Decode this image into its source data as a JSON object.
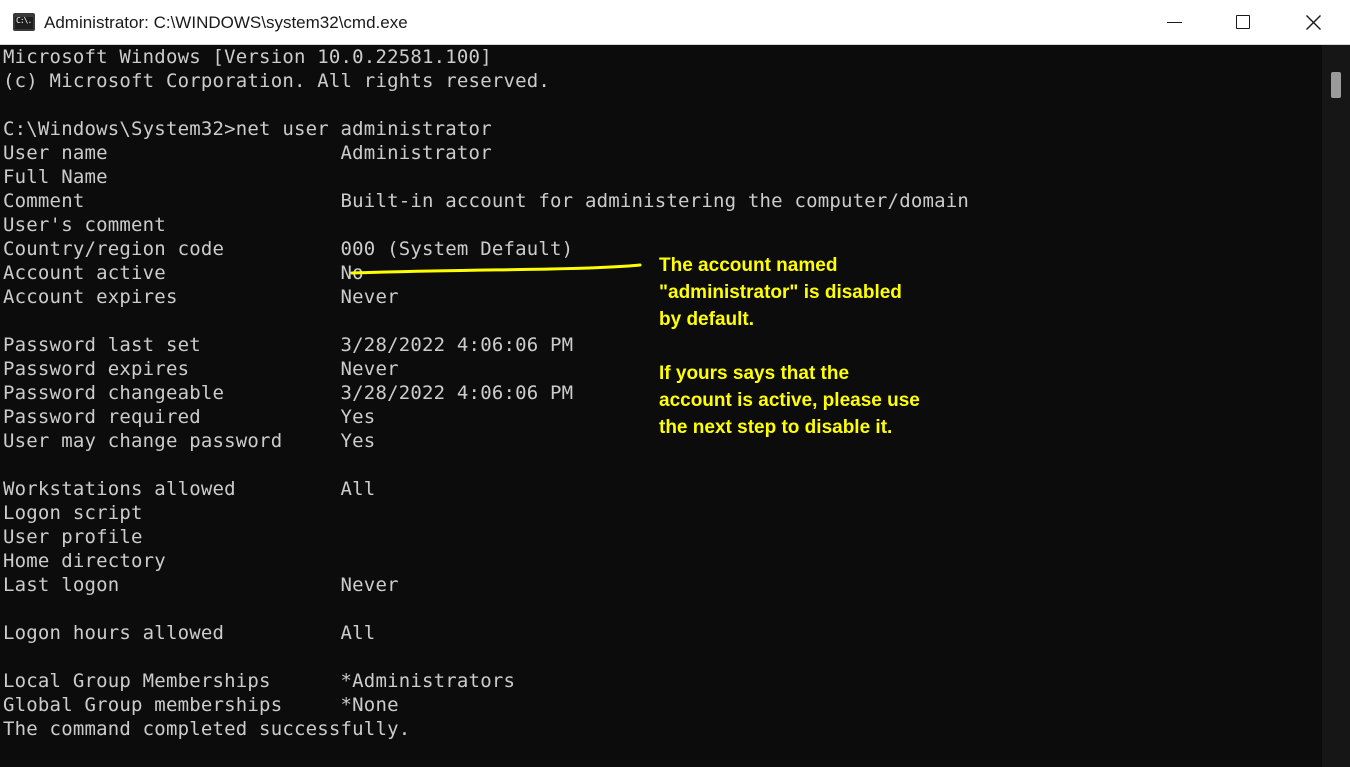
{
  "window": {
    "title": "Administrator: C:\\WINDOWS\\system32\\cmd.exe",
    "icon_label": "C:\\."
  },
  "console": {
    "lines": [
      "Microsoft Windows [Version 10.0.22581.100]",
      "(c) Microsoft Corporation. All rights reserved.",
      "",
      "C:\\Windows\\System32>net user administrator",
      "User name                    Administrator",
      "Full Name",
      "Comment                      Built-in account for administering the computer/domain",
      "User's comment",
      "Country/region code          000 (System Default)",
      "Account active               No",
      "Account expires              Never",
      "",
      "Password last set            3/28/2022 4:06:06 PM",
      "Password expires             Never",
      "Password changeable          3/28/2022 4:06:06 PM",
      "Password required            Yes",
      "User may change password     Yes",
      "",
      "Workstations allowed         All",
      "Logon script",
      "User profile",
      "Home directory",
      "Last logon                   Never",
      "",
      "Logon hours allowed          All",
      "",
      "Local Group Memberships      *Administrators",
      "Global Group memberships     *None",
      "The command completed successfully."
    ]
  },
  "annotation": {
    "paragraph1": [
      "The account named",
      "\"administrator\" is disabled",
      "by default."
    ],
    "paragraph2": [
      "If yours says that the",
      "account is active, please use",
      "the next step to disable it."
    ]
  },
  "colors": {
    "console_background": "#0c0c0c",
    "console_text": "#cccccc",
    "annotation": "#ffff00",
    "titlebar": "#ffffff"
  },
  "icons": {
    "app": "cmd-icon",
    "minimize": "minimize-icon",
    "maximize": "maximize-icon",
    "close": "close-icon"
  }
}
